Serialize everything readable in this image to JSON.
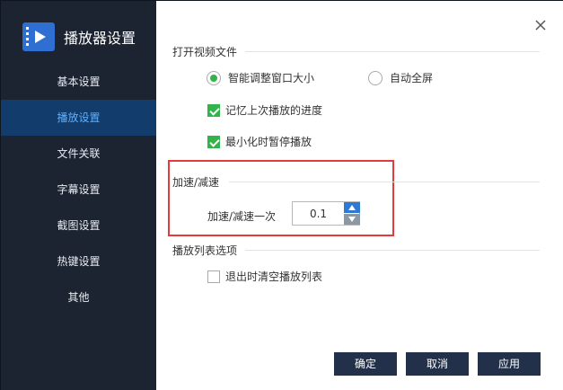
{
  "app": {
    "title": "播放器设置"
  },
  "sidebar": {
    "items": [
      {
        "label": "基本设置",
        "active": false
      },
      {
        "label": "播放设置",
        "active": true
      },
      {
        "label": "文件关联",
        "active": false
      },
      {
        "label": "字幕设置",
        "active": false
      },
      {
        "label": "截图设置",
        "active": false
      },
      {
        "label": "热键设置",
        "active": false
      },
      {
        "label": "其他",
        "active": false
      }
    ]
  },
  "sections": {
    "open_file": {
      "title": "打开视频文件",
      "radio_smart": {
        "label": "智能调整窗口大小",
        "checked": true
      },
      "radio_fullscreen": {
        "label": "自动全屏",
        "checked": false
      },
      "check_remember": {
        "label": "记忆上次播放的进度",
        "checked": true
      },
      "check_minimize": {
        "label": "最小化时暂停播放",
        "checked": true
      }
    },
    "speed": {
      "title": "加速/减速",
      "step_label": "加速/减速一次",
      "step_value": "0.1"
    },
    "playlist": {
      "title": "播放列表选项",
      "check_clear": {
        "label": "退出时清空播放列表",
        "checked": false
      }
    }
  },
  "footer": {
    "ok": "确定",
    "cancel": "取消",
    "apply": "应用"
  },
  "colors": {
    "sidebar_bg": "#1c2431",
    "active_item_bg": "#123c6c",
    "active_item_text": "#5eb0ff",
    "accent_green": "#32b44a",
    "button_bg": "#22304a",
    "highlight_red": "#e53a3a"
  }
}
